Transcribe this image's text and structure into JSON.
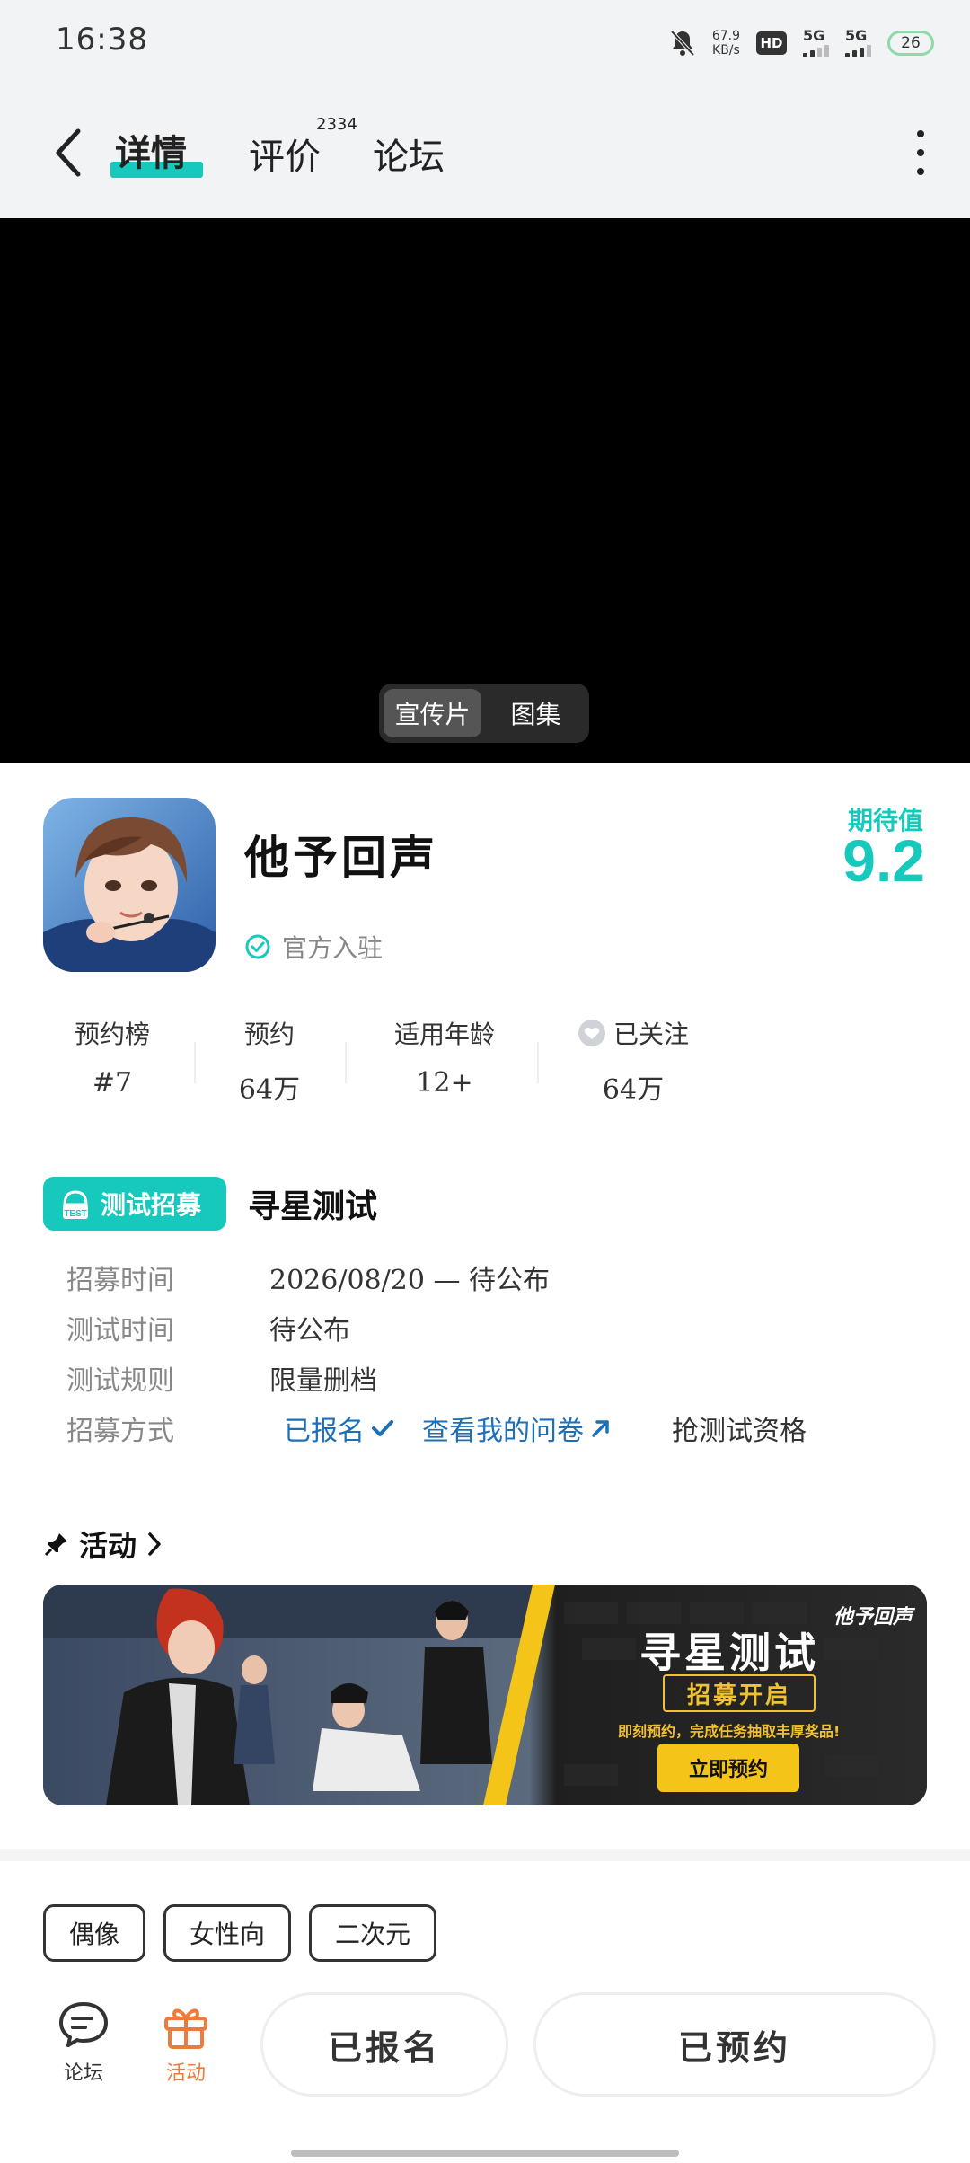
{
  "status_bar": {
    "time": "16:38",
    "net_speed": "67.9",
    "net_unit": "KB/s",
    "hd": "HD",
    "sim1": "5G",
    "sim2": "5G",
    "battery": "26"
  },
  "header": {
    "tabs": [
      {
        "label": "详情",
        "active": true
      },
      {
        "label": "评价",
        "count": "2334"
      },
      {
        "label": "论坛"
      }
    ]
  },
  "media": {
    "options": [
      "宣传片",
      "图集"
    ],
    "selected": "宣传片"
  },
  "game": {
    "title": "他予回声",
    "official_label": "官方入驻",
    "expect_label": "期待值",
    "expect_value": "9.2"
  },
  "stats": [
    {
      "label": "预约榜",
      "value": "#7"
    },
    {
      "label": "预约",
      "value": "64万"
    },
    {
      "label": "适用年龄",
      "value": "12+"
    },
    {
      "label": "已关注",
      "value": "64万"
    }
  ],
  "recruit": {
    "badge": "测试招募",
    "badge_small": "TEST",
    "title": "寻星测试",
    "rows": [
      {
        "label": "招募时间",
        "value": "2026/08/20 — 待公布"
      },
      {
        "label": "测试时间",
        "value": "待公布"
      },
      {
        "label": "测试规则",
        "value": "限量删档"
      },
      {
        "label": "招募方式",
        "signed": "已报名",
        "survey": "查看我的问卷",
        "grab": "抢测试资格"
      }
    ]
  },
  "activity": {
    "heading": "活动",
    "banner": {
      "title": "寻星测试",
      "chip": "招募开启",
      "subtitle": "即刻预约，完成任务抽取丰厚奖品!",
      "button": "立即预约",
      "logo": "他予回声"
    }
  },
  "tags": [
    "偶像",
    "女性向",
    "二次元"
  ],
  "bottom": {
    "forum": "论坛",
    "activity": "活动",
    "signed_btn": "已报名",
    "reserved_btn": "已预约"
  },
  "colors": {
    "accent": "#17c8bd",
    "link": "#1d6fb8",
    "activity_orange": "#f07a3a",
    "banner_yellow": "#f5c418"
  }
}
